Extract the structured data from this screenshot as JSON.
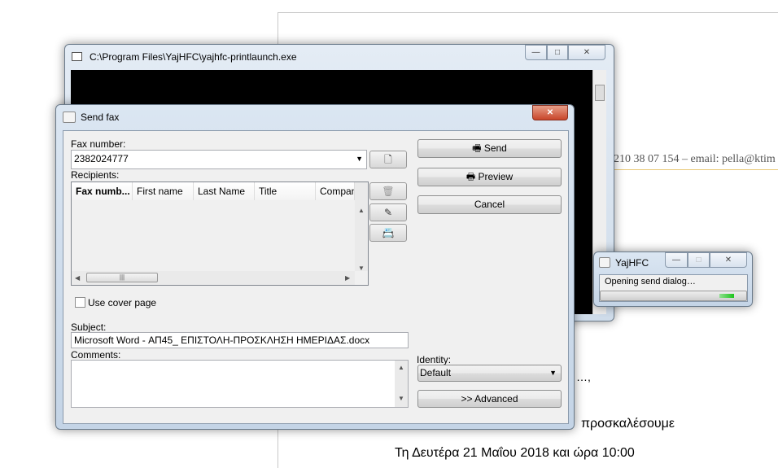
{
  "document": {
    "contact_line": "210 38 07 154 – email: pella@ktim",
    "line1": "…,",
    "line2": "προσκαλέσουμε",
    "line3": "Τη Δευτέρα 21 Μαΐου 2018 και ώρα 10:00"
  },
  "console": {
    "title": "C:\\Program Files\\YajHFC\\yajhfc-printlaunch.exe",
    "minimize": "—",
    "maximize": "□",
    "close": "✕"
  },
  "send_fax": {
    "title": "Send fax",
    "close": "✕",
    "fax_number_label": "Fax number:",
    "fax_number_value": "2382024777",
    "recipients_label": "Recipients:",
    "columns": [
      "Fax numb...",
      "First name",
      "Last Name",
      "Title",
      "Company"
    ],
    "use_cover_page_label": "Use cover page",
    "use_cover_page_checked": false,
    "subject_label": "Subject:",
    "subject_value": "Microsoft Word - ΑΠ45_ ΕΠΙΣΤΟΛΗ-ΠΡΟΣΚΛΗΣΗ ΗΜΕΡΙΔΑΣ.docx",
    "comments_label": "Comments:",
    "comments_value": "",
    "send": "Send",
    "preview": "Preview",
    "cancel": "Cancel",
    "identity_label": "Identity:",
    "identity_value": "Default",
    "advanced": ">> Advanced"
  },
  "progress_window": {
    "title": "YajHFC",
    "message": "Opening send dialog…",
    "minimize": "—",
    "maximize": "□",
    "close": "✕",
    "indeterminate": true
  }
}
